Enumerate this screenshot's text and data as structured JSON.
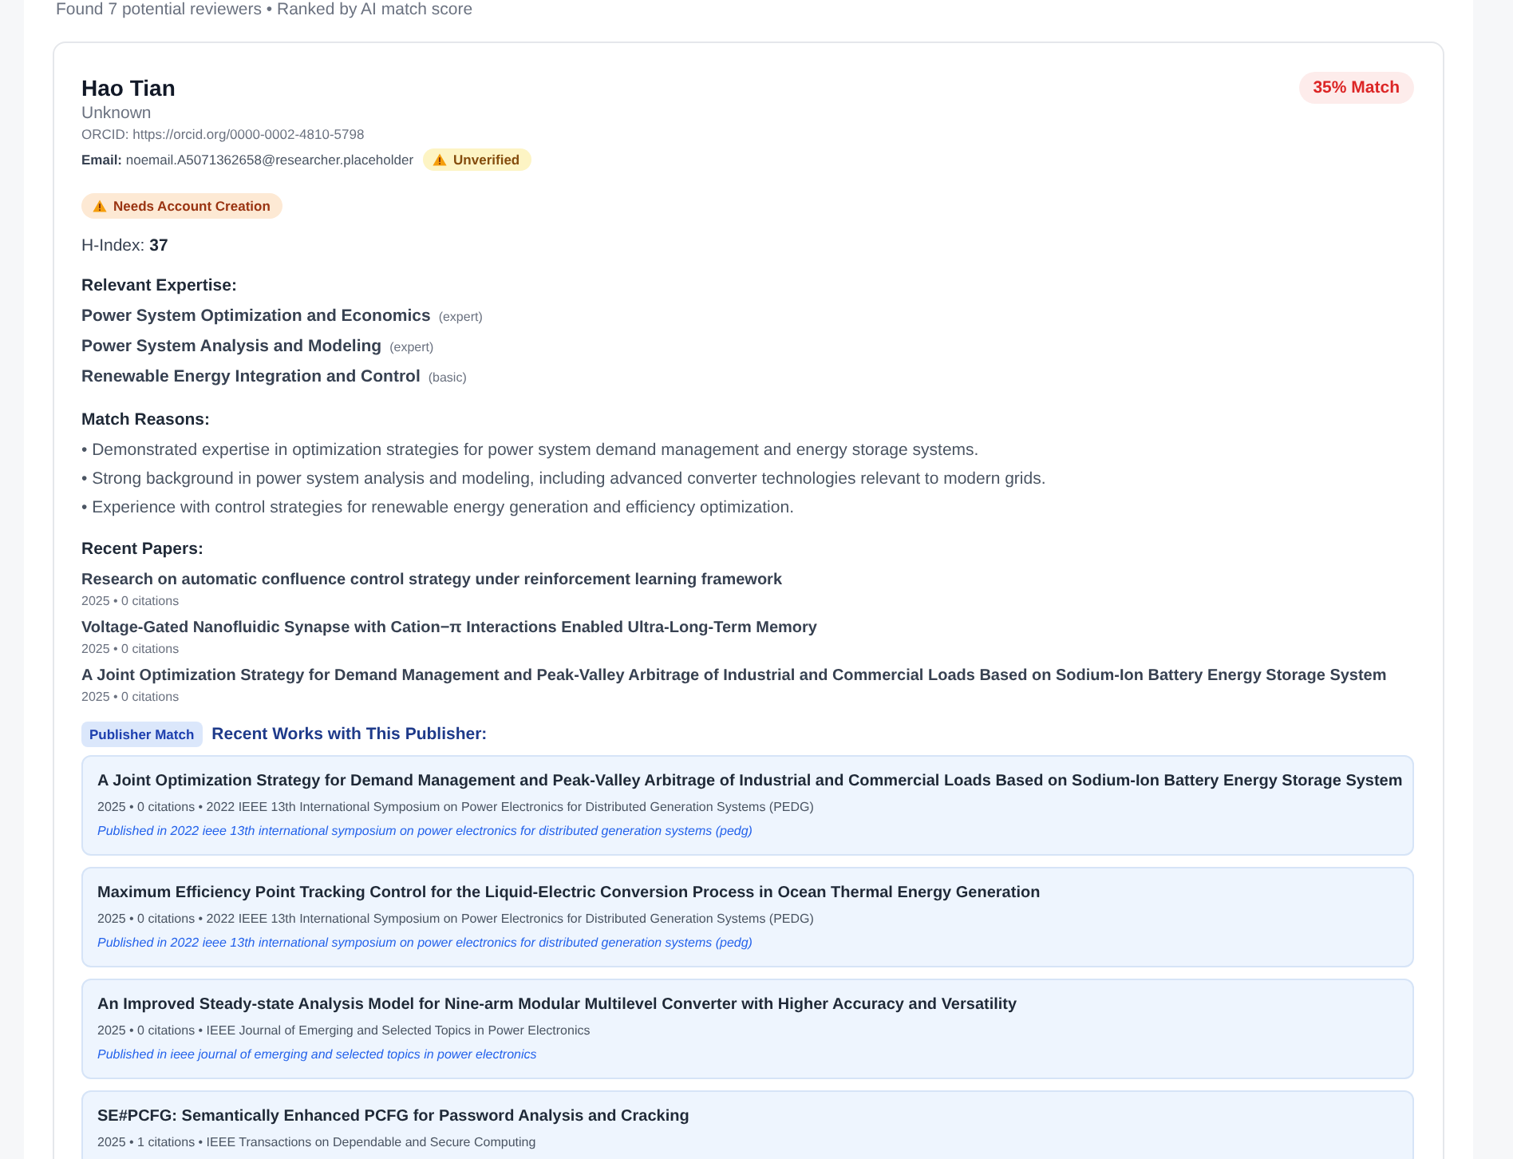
{
  "header": {
    "summary": "Found 7 potential reviewers • Ranked by AI match score"
  },
  "reviewer": {
    "name": "Hao Tian",
    "match_score": "35% Match",
    "affiliation": "Unknown",
    "orcid": "ORCID: https://orcid.org/0000-0002-4810-5798",
    "email": {
      "text": "**Email:** noemail.A5071362658@researcher.placeholder",
      "badge": {
        "label": "Unverified",
        "kind": "caution"
      }
    },
    "account_badge": {
      "label": "Needs Account Creation",
      "kind": "alert"
    },
    "h_index": "H-Index: **37**",
    "expertise_title": "Relevant Expertise:",
    "expertise": [
      {
        "topic": "Power System Optimization and Economics",
        "proficiency": "(expert)"
      },
      {
        "topic": "Power System Analysis and Modeling",
        "proficiency": "(expert)"
      },
      {
        "topic": "Renewable Energy Integration and Control",
        "proficiency": "(basic)"
      }
    ],
    "match_reasons_title": "Match Reasons:",
    "match_reasons": [
      "• Demonstrated expertise in optimization strategies for power system demand management and energy storage systems.",
      "• Strong background in power system analysis and modeling, including advanced converter technologies relevant to modern grids.",
      "• Experience with control strategies for renewable energy generation and efficiency optimization."
    ],
    "recent_papers_title": "Recent Papers:",
    "recent_papers": [
      {
        "title": "Research on automatic confluence control strategy under reinforcement learning framework",
        "meta": "2025 • 0 citations"
      },
      {
        "title": "Voltage-Gated Nanofluidic Synapse with Cation−π Interactions Enabled Ultra-Long-Term Memory",
        "meta": "2025 • 0 citations"
      },
      {
        "title": "A Joint Optimization Strategy for Demand Management and Peak-Valley Arbitrage of Industrial and Commercial Loads Based on Sodium-Ion Battery Energy Storage System",
        "meta": "2025 • 0 citations"
      }
    ],
    "publisher": {
      "badge": "Publisher Match",
      "title": "Recent Works with This Publisher:",
      "works": [
        {
          "title": "A Joint Optimization Strategy for Demand Management and Peak-Valley Arbitrage of Industrial and Commercial Loads Based on Sodium-Ion Battery Energy Storage System",
          "meta": "2025 • 0 citations • 2022 IEEE 13th International Symposium on Power Electronics for Distributed Generation Systems (PEDG)",
          "note": "Published in 2022 ieee 13th international symposium on power electronics for distributed generation systems (pedg)"
        },
        {
          "title": "Maximum Efficiency Point Tracking Control for the Liquid-Electric Conversion Process in Ocean Thermal Energy Generation",
          "meta": "2025 • 0 citations • 2022 IEEE 13th International Symposium on Power Electronics for Distributed Generation Systems (PEDG)",
          "note": "Published in 2022 ieee 13th international symposium on power electronics for distributed generation systems (pedg)"
        },
        {
          "title": "An Improved Steady-state Analysis Model for Nine-arm Modular Multilevel Converter with Higher Accuracy and Versatility",
          "meta": "2025 • 0 citations • IEEE Journal of Emerging and Selected Topics in Power Electronics",
          "note": "Published in ieee journal of emerging and selected topics in power electronics"
        },
        {
          "title": "SE#PCFG: Semantically Enhanced PCFG for Password Analysis and Cracking",
          "meta": "2025 • 1 citations • IEEE Transactions on Dependable and Secure Computing"
        }
      ]
    }
  }
}
